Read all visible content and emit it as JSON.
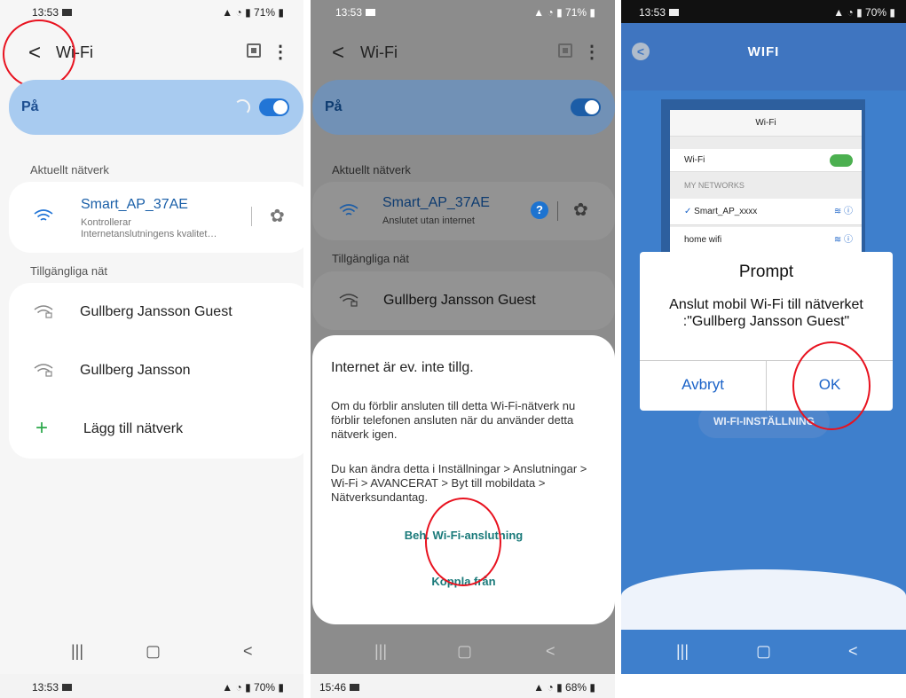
{
  "p1": {
    "status_time": "13:53",
    "status_right": "71%",
    "title": "Wi-Fi",
    "on_label": "På",
    "current_header": "Aktuellt nätverk",
    "current_name": "Smart_AP_37AE",
    "current_sub1": "Kontrollerar",
    "current_sub2": "Internetanslutningens kvalitet…",
    "available_header": "Tillgängliga nät",
    "networks": [
      "Gullberg Jansson Guest",
      "Gullberg Jansson"
    ],
    "add_network": "Lägg till nätverk"
  },
  "p2": {
    "status_time": "13:53",
    "status_right": "71%",
    "title": "Wi-Fi",
    "on_label": "På",
    "current_header": "Aktuellt nätverk",
    "current_name": "Smart_AP_37AE",
    "current_sub": "Anslutet utan internet",
    "available_header": "Tillgängliga nät",
    "network": "Gullberg Jansson Guest",
    "dialog_title": "Internet är ev. inte tillg.",
    "dialog_body1": "Om du förblir ansluten till detta Wi-Fi-nätverk nu förblir telefonen ansluten när du använder detta nätverk igen.",
    "dialog_body2": "Du kan ändra detta i Inställningar > Anslutningar > Wi-Fi > AVANCERAT > Byt till mobildata > Nätverksundantag.",
    "keep_button": "Beh. Wi-Fi-anslutning",
    "disconnect_button": "Koppla från"
  },
  "p3": {
    "status_time": "13:53",
    "status_right": "70%",
    "header_title": "WIFI",
    "mock_title": "Wi-Fi",
    "mock_wifi": "Wi-Fi",
    "mock_mynetworks": "MY NETWORKS",
    "mock_net1": "Smart_AP_xxxx",
    "mock_net2": "home wifi",
    "dialog_title": "Prompt",
    "dialog_message": "Anslut mobil Wi-Fi till nätverket :\"Gullberg Jansson Guest\"",
    "cancel": "Avbryt",
    "ok": "OK",
    "wifi_settings_button": "WI-FI-INSTÄLLNING"
  },
  "bottom": {
    "s1_time": "13:53",
    "s1_right": "70%",
    "s2_time": "15:46",
    "s2_right": "68%"
  },
  "colors": {
    "accent": "#2275d6",
    "annotation": "#e8121f",
    "link": "#1a7a7a"
  }
}
